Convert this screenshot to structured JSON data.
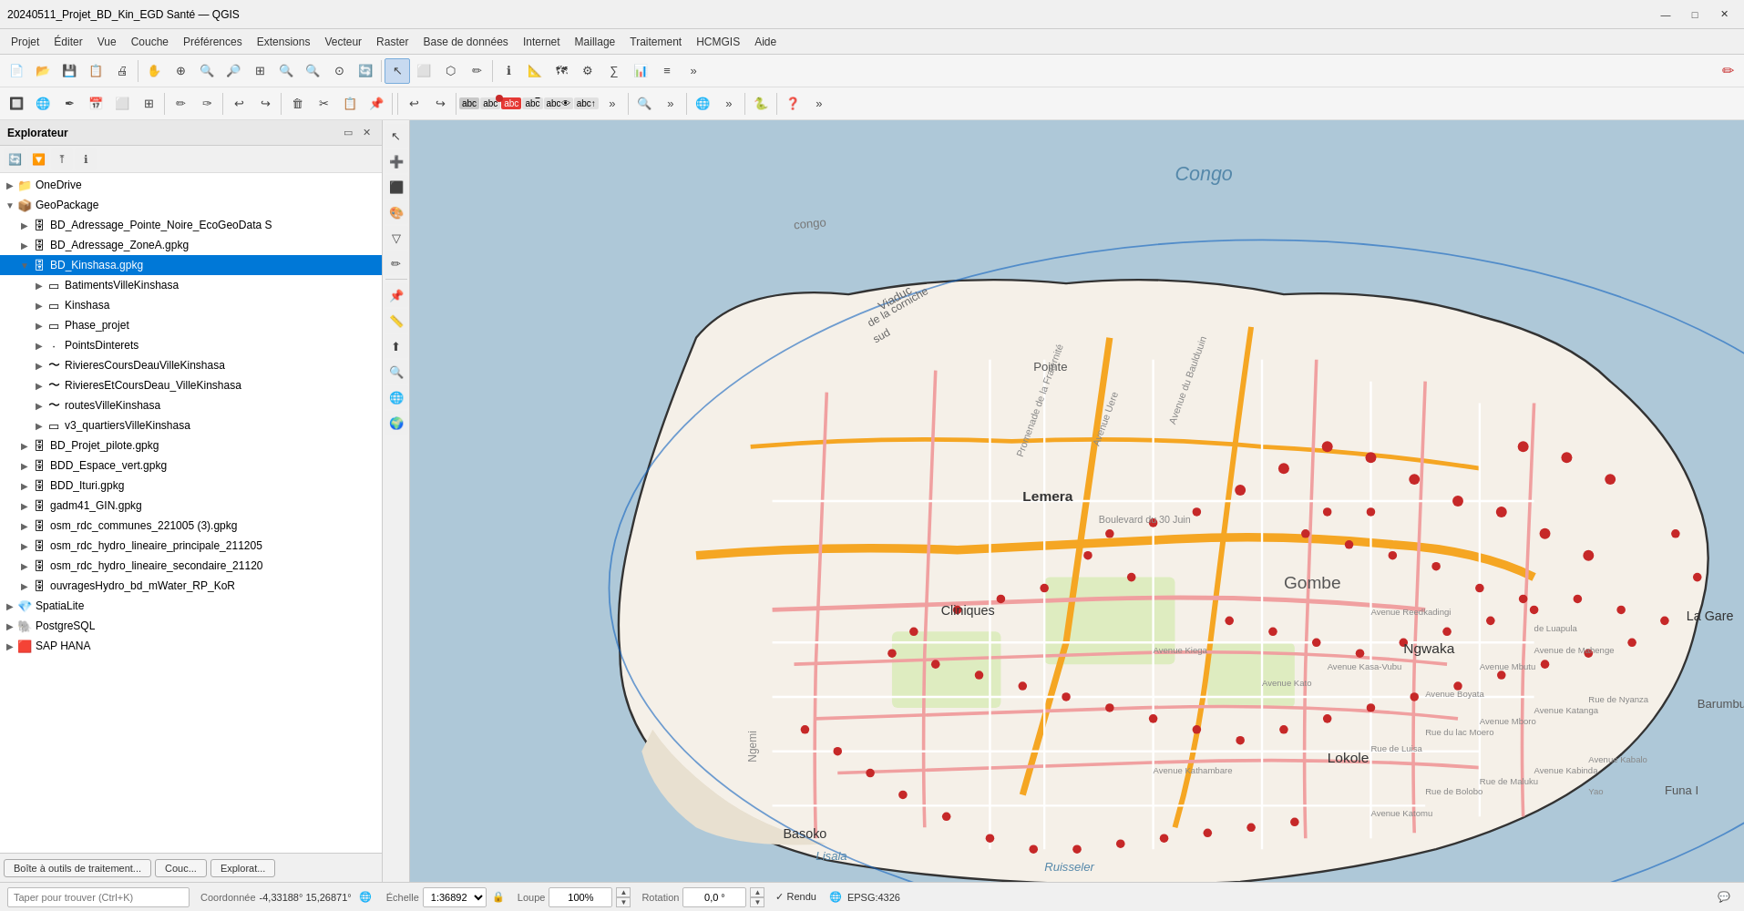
{
  "titlebar": {
    "title": "20240511_Projet_BD_Kin_EGD Santé — QGIS",
    "minimize": "—",
    "maximize": "□",
    "close": "✕"
  },
  "menubar": {
    "items": [
      "Projet",
      "Éditer",
      "Vue",
      "Couche",
      "Préférences",
      "Extensions",
      "Vecteur",
      "Raster",
      "Base de données",
      "Internet",
      "Maillage",
      "Traitement",
      "HCMGIS",
      "Aide"
    ]
  },
  "explorer": {
    "title": "Explorateur",
    "tree": [
      {
        "id": "onedrive",
        "label": "OneDrive",
        "level": 0,
        "icon": "📁",
        "arrow": "▶",
        "selected": false
      },
      {
        "id": "geopackage",
        "label": "GeoPackage",
        "level": 0,
        "icon": "📦",
        "arrow": "▼",
        "selected": false
      },
      {
        "id": "bd-adressage-pn",
        "label": "BD_Adressage_Pointe_Noire_EcoGeoData S",
        "level": 1,
        "icon": "🗄",
        "arrow": "▶",
        "selected": false
      },
      {
        "id": "bd-adressage-zone",
        "label": "BD_Adressage_ZoneA.gpkg",
        "level": 1,
        "icon": "🗄",
        "arrow": "▶",
        "selected": false
      },
      {
        "id": "bd-kinshasa",
        "label": "BD_Kinshasa.gpkg",
        "level": 1,
        "icon": "🗄",
        "arrow": "▼",
        "selected": true
      },
      {
        "id": "batiments",
        "label": "BatimentsVilleKinshasa",
        "level": 2,
        "icon": "▭",
        "arrow": "▶",
        "selected": false
      },
      {
        "id": "kinshasa",
        "label": "Kinshasa",
        "level": 2,
        "icon": "▭",
        "arrow": "▶",
        "selected": false
      },
      {
        "id": "phase-projet",
        "label": "Phase_projet",
        "level": 2,
        "icon": "▭",
        "arrow": "▶",
        "selected": false
      },
      {
        "id": "points-dinterets",
        "label": "PointsDinterets",
        "level": 2,
        "icon": "·",
        "arrow": "▶",
        "selected": false
      },
      {
        "id": "rivieres-cours",
        "label": "RivieresCoursDeauVilleKinshasa",
        "level": 2,
        "icon": "〜",
        "arrow": "▶",
        "selected": false
      },
      {
        "id": "rivieres-et-cours",
        "label": "RivieresEtCoursDeau_VilleKinshasa",
        "level": 2,
        "icon": "〜",
        "arrow": "▶",
        "selected": false
      },
      {
        "id": "routes",
        "label": "routesVilleKinshasa",
        "level": 2,
        "icon": "〜",
        "arrow": "▶",
        "selected": false
      },
      {
        "id": "v3-quartiers",
        "label": "v3_quartiersVilleKinshasa",
        "level": 2,
        "icon": "▭",
        "arrow": "▶",
        "selected": false
      },
      {
        "id": "bd-projet-pilote",
        "label": "BD_Projet_pilote.gpkg",
        "level": 1,
        "icon": "🗄",
        "arrow": "▶",
        "selected": false
      },
      {
        "id": "bdd-espace-vert",
        "label": "BDD_Espace_vert.gpkg",
        "level": 1,
        "icon": "🗄",
        "arrow": "▶",
        "selected": false
      },
      {
        "id": "bdd-ituri",
        "label": "BDD_Ituri.gpkg",
        "level": 1,
        "icon": "🗄",
        "arrow": "▶",
        "selected": false
      },
      {
        "id": "gadm41-gin",
        "label": "gadm41_GIN.gpkg",
        "level": 1,
        "icon": "🗄",
        "arrow": "▶",
        "selected": false
      },
      {
        "id": "osm-communes",
        "label": "osm_rdc_communes_221005 (3).gpkg",
        "level": 1,
        "icon": "🗄",
        "arrow": "▶",
        "selected": false
      },
      {
        "id": "osm-hydro-lin-prin",
        "label": "osm_rdc_hydro_lineaire_principale_211205",
        "level": 1,
        "icon": "🗄",
        "arrow": "▶",
        "selected": false
      },
      {
        "id": "osm-hydro-lin-sec",
        "label": "osm_rdc_hydro_lineaire_secondaire_21120",
        "level": 1,
        "icon": "🗄",
        "arrow": "▶",
        "selected": false
      },
      {
        "id": "ouvrages-hydro",
        "label": "ouvragesHydro_bd_mWater_RP_KoR",
        "level": 1,
        "icon": "🗄",
        "arrow": "▶",
        "selected": false
      },
      {
        "id": "spatialite",
        "label": "SpatiaLite",
        "level": 0,
        "icon": "💎",
        "arrow": "▶",
        "selected": false
      },
      {
        "id": "postgresql",
        "label": "PostgreSQL",
        "level": 0,
        "icon": "🐘",
        "arrow": "▶",
        "selected": false
      },
      {
        "id": "sap-hana",
        "label": "SAP HANA",
        "level": 0,
        "icon": "🟥",
        "arrow": "▶",
        "selected": false
      }
    ],
    "buttons": [
      "Boîte à outils de traitement...",
      "Couc...",
      "Explorat..."
    ]
  },
  "statusbar": {
    "search_placeholder": "Taper pour trouver (Ctrl+K)",
    "coord_label": "Coordonnée",
    "coord_value": "-4,33188°  15,26871°",
    "scale_label": "Échelle",
    "scale_value": "1:36892",
    "loupe_label": "Loupe",
    "loupe_value": "100%",
    "rotation_label": "Rotation",
    "rotation_value": "0,0 °",
    "rendu_label": "✓ Rendu",
    "epsg_value": "EPSG:4326"
  },
  "map": {
    "labels": [
      "Congo",
      "Lemera",
      "Gombe",
      "Cliniques",
      "La Gare",
      "Ngwaka",
      "Lokole",
      "Basoko",
      "Funa I",
      "Barumbu",
      "Pointe"
    ],
    "water_color": "#aec8d8",
    "land_color": "#f5f0e8",
    "road_orange": "#f5a623",
    "road_pink": "#f0b0b0",
    "boundary_color": "#333"
  }
}
